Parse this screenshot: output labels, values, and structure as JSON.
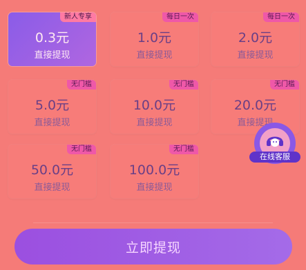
{
  "options": [
    {
      "amount": "0.3元",
      "sub": "直接提现",
      "badge": "新人专享",
      "selected": true
    },
    {
      "amount": "1.0元",
      "sub": "直接提现",
      "badge": "每日一次",
      "selected": false
    },
    {
      "amount": "2.0元",
      "sub": "直接提现",
      "badge": "每日一次",
      "selected": false
    },
    {
      "amount": "5.0元",
      "sub": "直接提现",
      "badge": "无门槛",
      "selected": false
    },
    {
      "amount": "10.0元",
      "sub": "直接提现",
      "badge": "无门槛",
      "selected": false
    },
    {
      "amount": "20.0元",
      "sub": "直接提现",
      "badge": "无门槛",
      "selected": false
    },
    {
      "amount": "50.0元",
      "sub": "直接提现",
      "badge": "无门槛",
      "selected": false
    },
    {
      "amount": "100.0元",
      "sub": "直接提现",
      "badge": "无门槛",
      "selected": false
    }
  ],
  "service": {
    "label": "在线客服",
    "icon": "customer-service-icon"
  },
  "cta": {
    "label": "立即提现"
  },
  "colors": {
    "background": "#f57b78",
    "accent": "#9b4fe0",
    "badge": "#ef58a8"
  }
}
